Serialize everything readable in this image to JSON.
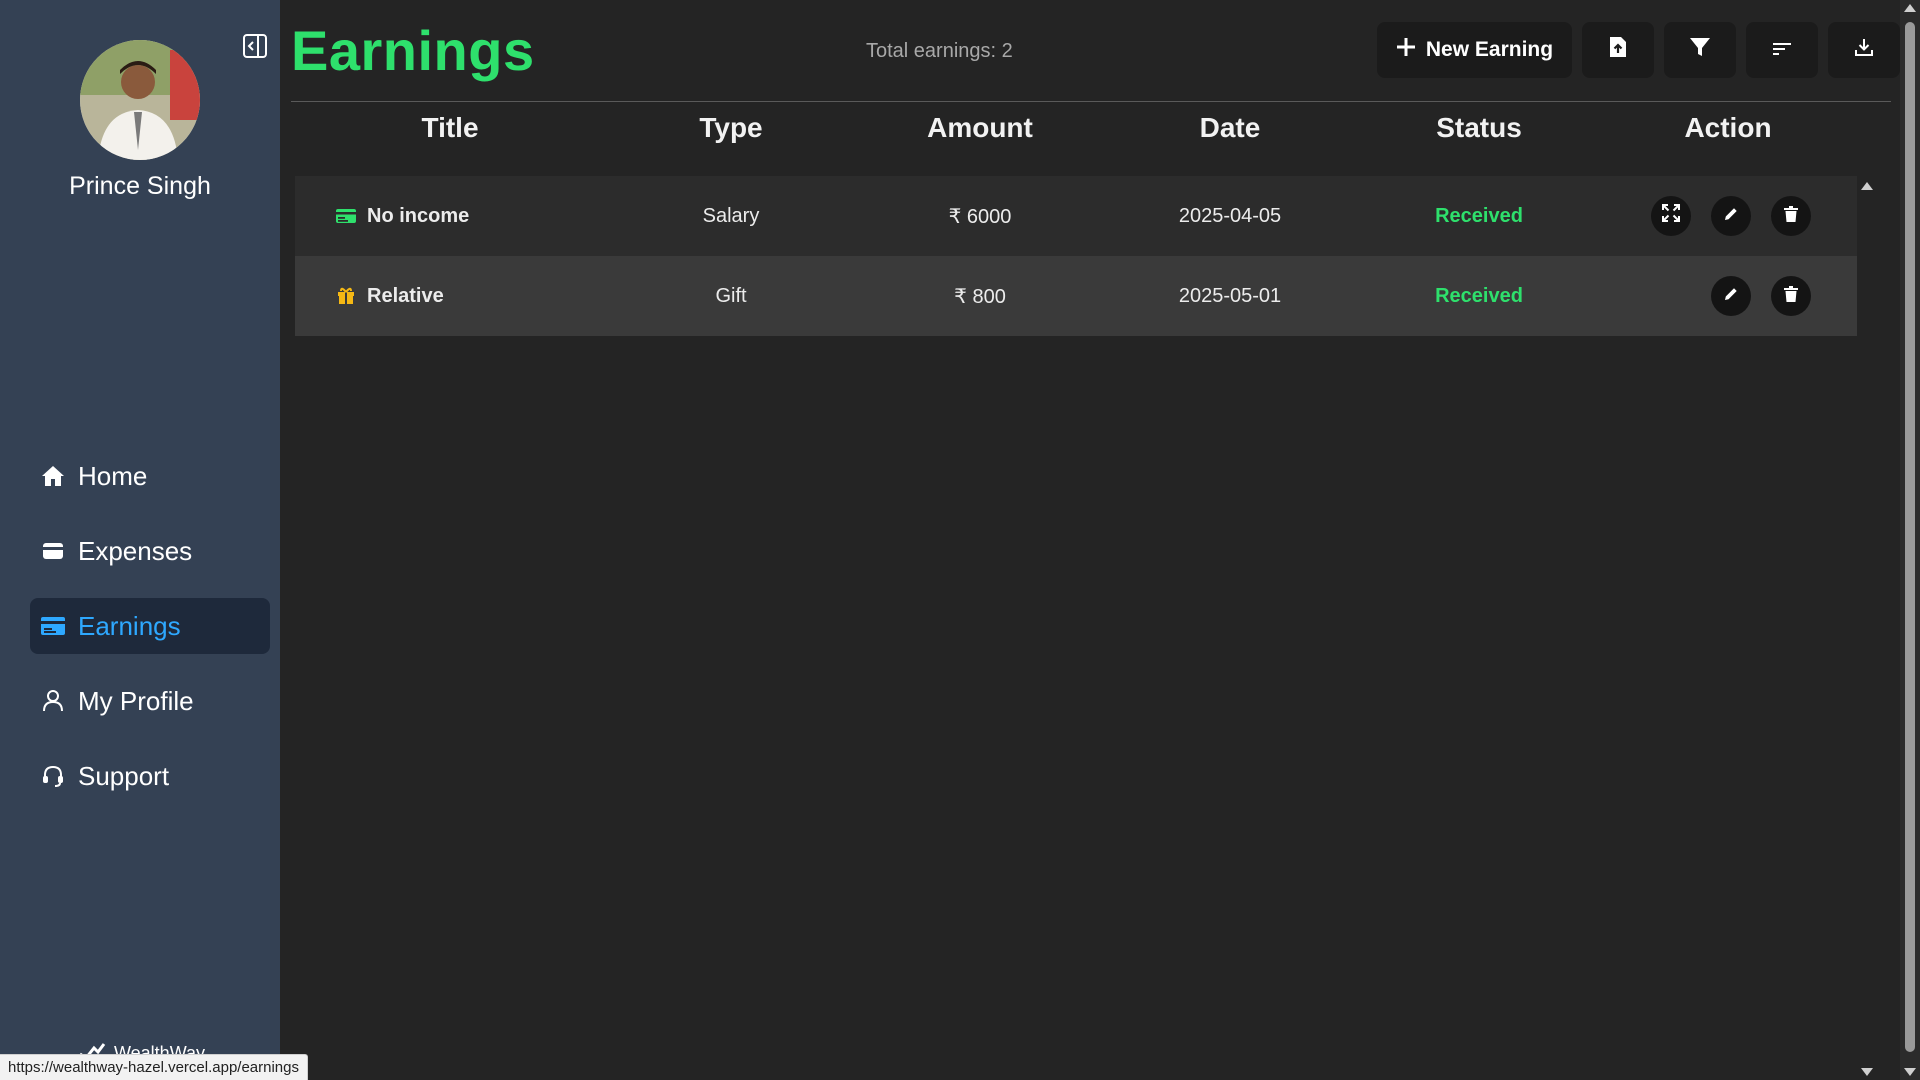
{
  "sidebar": {
    "user_name": "Prince Singh",
    "nav": [
      {
        "label": "Home",
        "icon": "home-icon"
      },
      {
        "label": "Expenses",
        "icon": "wallet-icon"
      },
      {
        "label": "Earnings",
        "icon": "credit-card-icon",
        "active": true
      },
      {
        "label": "My Profile",
        "icon": "user-icon"
      },
      {
        "label": "Support",
        "icon": "headset-icon"
      }
    ],
    "brand_peek": "WealthWay"
  },
  "header": {
    "title": "Earnings",
    "total_label": "Total earnings: 2",
    "new_button": "New Earning"
  },
  "table": {
    "columns": [
      "Title",
      "Type",
      "Amount",
      "Date",
      "Status",
      "Action"
    ],
    "rows": [
      {
        "title": "No income",
        "type": "Salary",
        "amount": "₹ 6000",
        "date": "2025-04-05",
        "status": "Received",
        "icon": "credit-card-icon"
      },
      {
        "title": "Relative",
        "type": "Gift",
        "amount": "₹ 800",
        "date": "2025-05-01",
        "status": "Received",
        "icon": "gift-icon"
      }
    ]
  },
  "status_url": "https://wealthway-hazel.vercel.app/earnings",
  "colors": {
    "accent_green": "#2ee06c",
    "sidebar_bg": "#344154",
    "active_nav_bg": "#1e293b",
    "active_nav_text": "#2ea8ff",
    "gift_icon": "#f5b814"
  }
}
